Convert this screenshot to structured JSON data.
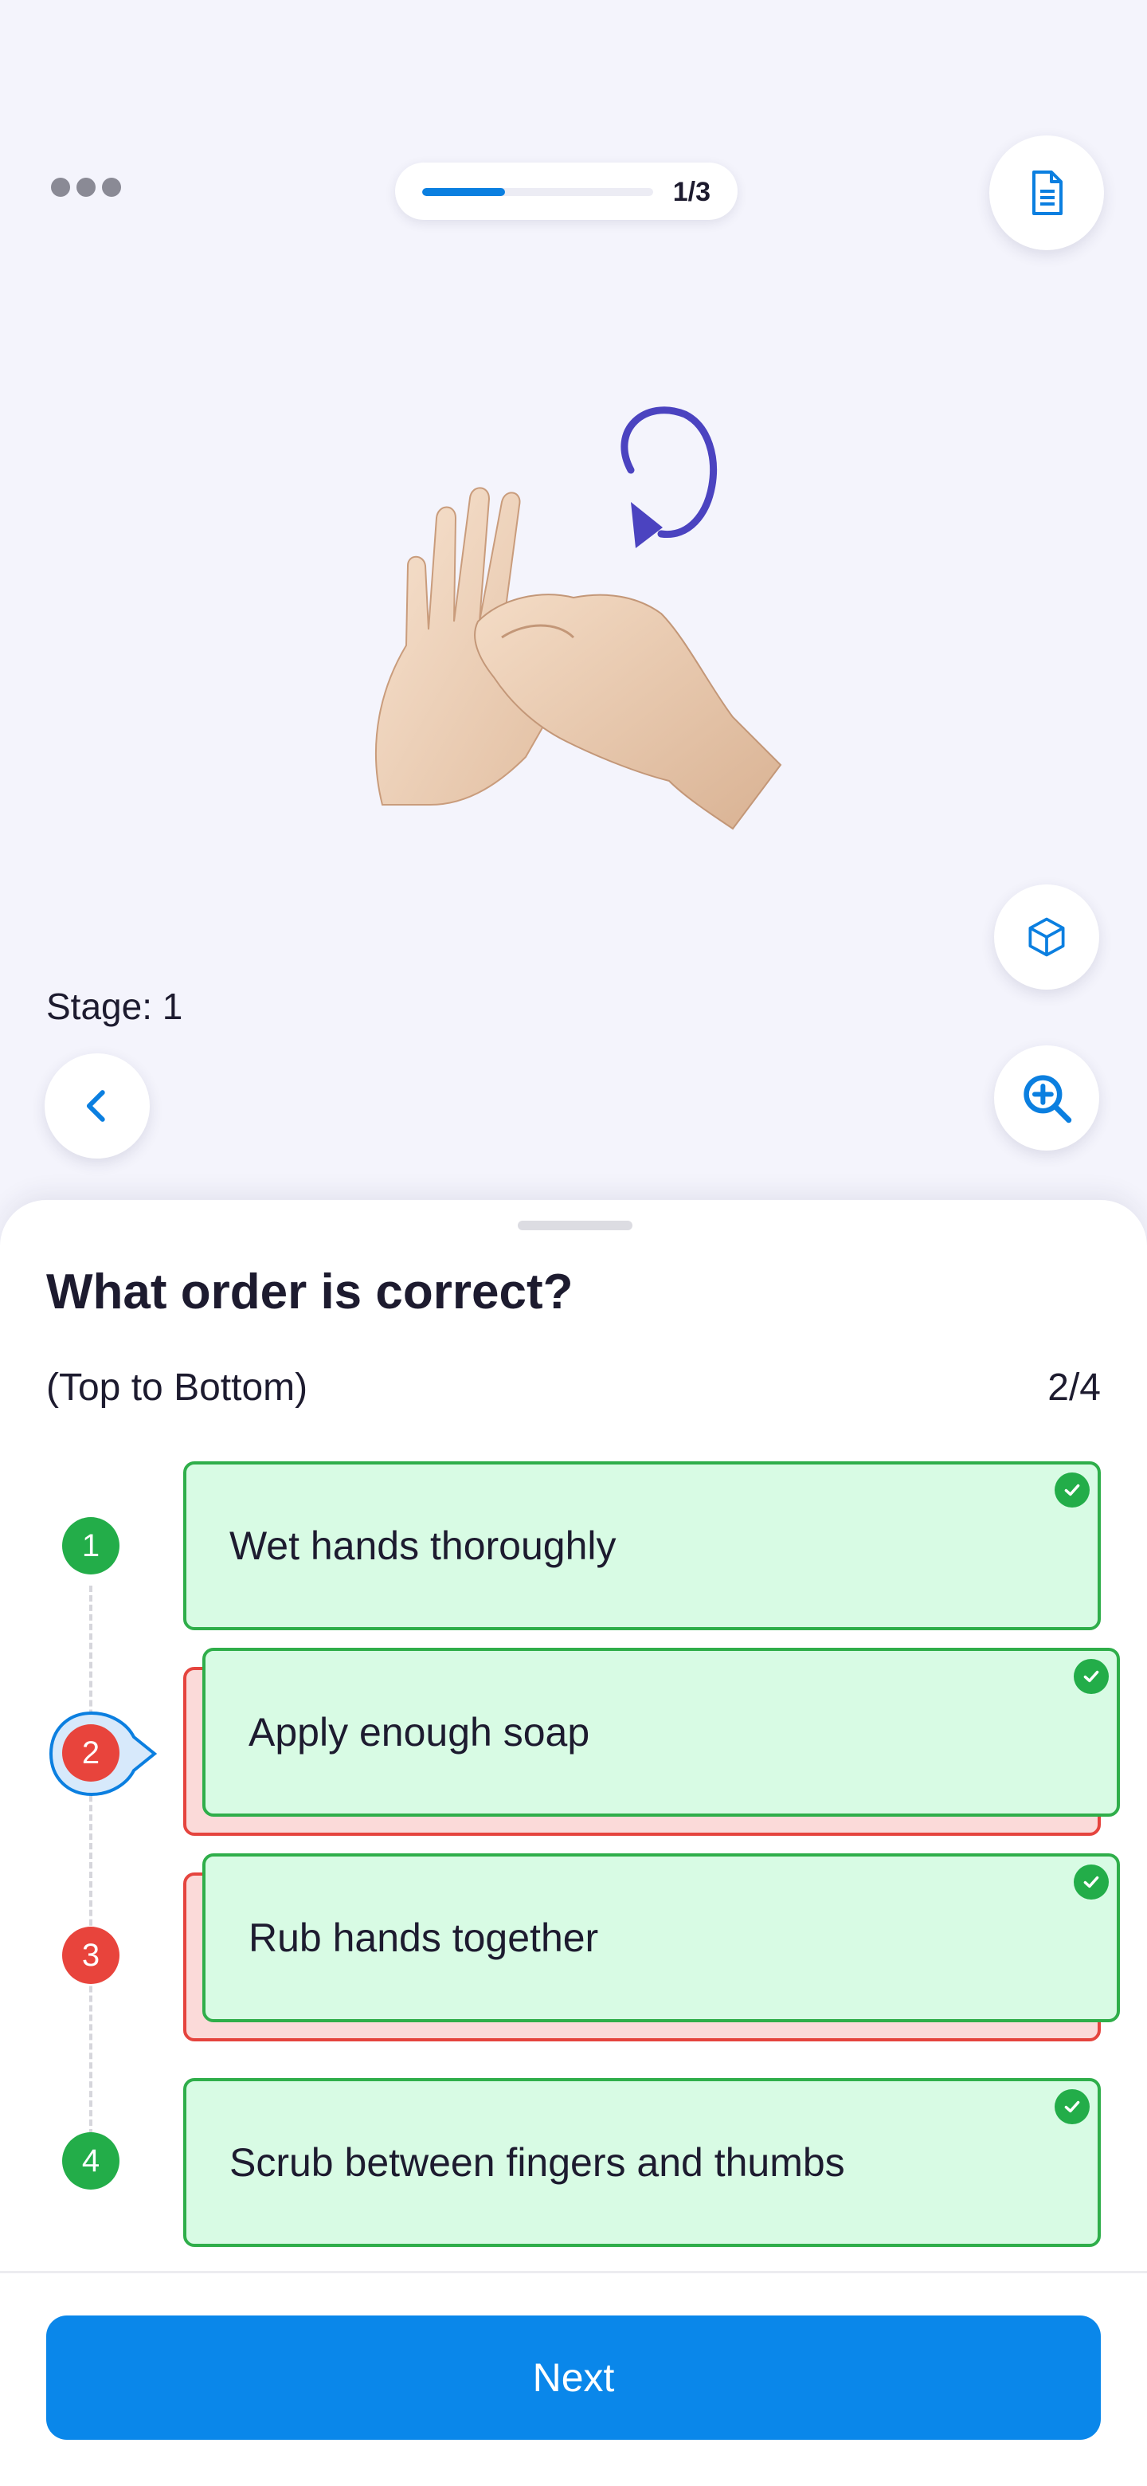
{
  "header": {
    "progress_text": "1/3",
    "progress_fraction": 0.36
  },
  "icons": {
    "menu": "more-dots-icon",
    "document": "document-icon",
    "cube": "cube-icon",
    "back": "chevron-left-icon",
    "zoom": "zoom-in-icon",
    "check": "check-icon",
    "model": "hands-rubbing-model",
    "rotate": "rotate-arrow-icon"
  },
  "viewer": {
    "stage_label": "Stage: 1"
  },
  "quiz": {
    "question": "What order is correct?",
    "subtitle": "(Top to Bottom)",
    "counter": "2/4",
    "steps": [
      {
        "number": "1",
        "label": "Wet hands thoroughly",
        "state": "correct"
      },
      {
        "number": "2",
        "label": "Apply enough soap",
        "state": "moved"
      },
      {
        "number": "3",
        "label": "Rub hands together",
        "state": "moved"
      },
      {
        "number": "4",
        "label": "Scrub between fingers and thumbs",
        "state": "correct"
      }
    ]
  },
  "footer": {
    "next_label": "Next"
  },
  "colors": {
    "accent": "#0a87ea",
    "correct": "#23ad49",
    "wrong": "#e8443c",
    "card_green": "#d8fbe4",
    "card_red": "#fbdad9",
    "background": "#f4f4fc"
  }
}
